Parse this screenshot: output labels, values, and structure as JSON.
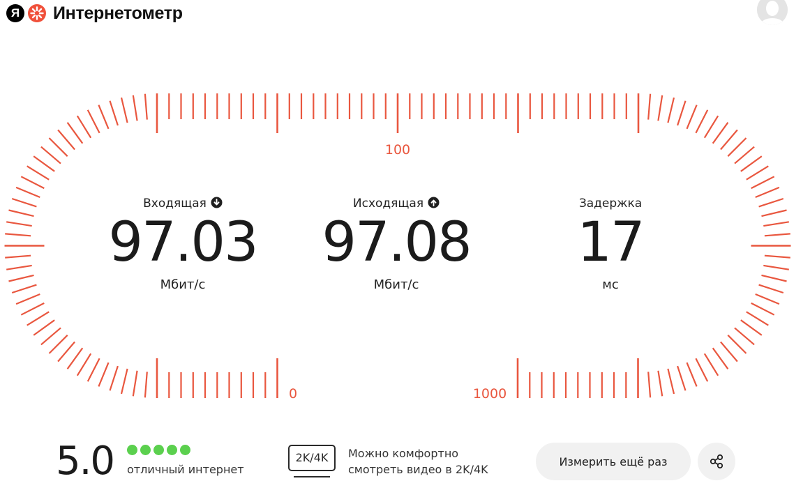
{
  "header": {
    "logo_letter": "Я",
    "title": "Интернетометр",
    "avatar_icon": "user-avatar-icon"
  },
  "gauge": {
    "accent_color": "#e9573f",
    "scale_labels": {
      "top": "100",
      "bottom_left": "0",
      "bottom_right": "1000"
    }
  },
  "metrics": {
    "download": {
      "label": "Входящая",
      "icon": "arrow-down-circle-icon",
      "value": "97.03",
      "unit": "Мбит/с"
    },
    "upload": {
      "label": "Исходящая",
      "icon": "arrow-up-circle-icon",
      "value": "97.08",
      "unit": "Мбит/с"
    },
    "latency": {
      "label": "Задержка",
      "value": "17",
      "unit": "мс"
    }
  },
  "rating": {
    "score": "5.0",
    "dots_filled": 5,
    "dots_total": 5,
    "dot_color": "#5bd04e",
    "caption": "отличный интернет"
  },
  "video_quality": {
    "badge": "2K/4K",
    "line1": "Можно комфортно",
    "line2": "смотреть видео в 2K/4K"
  },
  "actions": {
    "retry_label": "Измерить ещё раз",
    "share_icon": "share-icon"
  }
}
